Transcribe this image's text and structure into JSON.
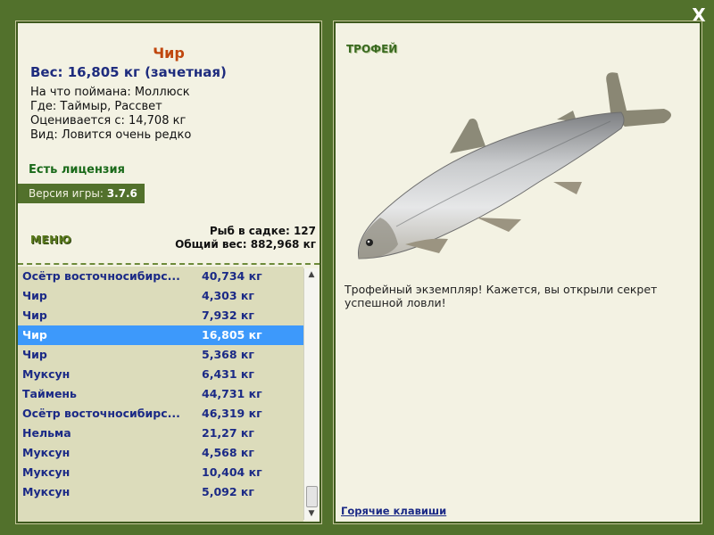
{
  "close_label": "X",
  "fish": {
    "title": "Чир",
    "weight": "Вес: 16,805 кг (зачетная)",
    "caught_on": "На что поймана: Моллюск",
    "location": "Где: Таймыр, Рассвет",
    "valued_from": "Оценивается с: 14,708 кг",
    "kind": "Вид: Ловится очень редко"
  },
  "license": "Есть лицензия",
  "version": {
    "label": "Версия игры: ",
    "value": "3.7.6"
  },
  "menu_label": "МЕНЮ",
  "keepnet": {
    "count": "Рыб в садке: 127",
    "total": "Общий вес: 882,968 кг"
  },
  "catch_list": [
    {
      "name": "Осётр восточносибирс...",
      "weight": "40,734 кг"
    },
    {
      "name": "Чир",
      "weight": "4,303 кг"
    },
    {
      "name": "Чир",
      "weight": "7,932 кг"
    },
    {
      "name": "Чир",
      "weight": "16,805 кг",
      "selected": true
    },
    {
      "name": "Чир",
      "weight": "5,368 кг"
    },
    {
      "name": "Муксун",
      "weight": "6,431 кг"
    },
    {
      "name": "Таймень",
      "weight": "44,731 кг"
    },
    {
      "name": "Осётр восточносибирс...",
      "weight": "46,319 кг"
    },
    {
      "name": "Нельма",
      "weight": "21,27 кг"
    },
    {
      "name": "Муксун",
      "weight": "4,568 кг"
    },
    {
      "name": "Муксун",
      "weight": "10,404 кг"
    },
    {
      "name": "Муксун",
      "weight": "5,092 кг"
    }
  ],
  "trophy_label": "ТРОФЕЙ",
  "trophy_text": "Трофейный экземпляр! Кажется, вы открыли секрет успешной ловли!",
  "hotkeys": "Горячие клавиши",
  "colors": {
    "frame_green": "#52712c",
    "panel_bg": "#f3f2e3",
    "list_bg": "#dcdcbb",
    "selection": "#3d99fb",
    "list_text": "#1b2a86",
    "title_orange": "#c0470e"
  },
  "icons": {
    "close": "close-icon",
    "scroll_up": "scroll-up-icon",
    "scroll_down": "scroll-down-icon"
  }
}
